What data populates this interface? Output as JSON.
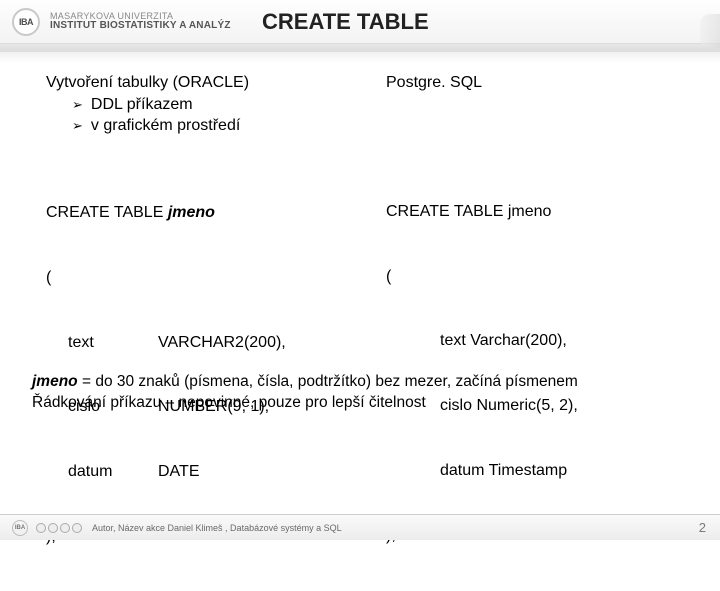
{
  "brand": {
    "logo_text": "IBA",
    "university": "MASARYKOVA UNIVERZITA",
    "institute": "INSTITUT BIOSTATISTIKY A ANALÝZ"
  },
  "title": "CREATE TABLE",
  "left": {
    "heading": "Vytvoření tabulky (ORACLE)",
    "bullets": [
      "DDL příkazem",
      "v grafickém prostředí"
    ],
    "sql": {
      "line1_a": "CREATE TABLE ",
      "line1_b": "jmeno",
      "open": "(",
      "rows": [
        {
          "col": "text",
          "type": "VARCHAR2(200),"
        },
        {
          "col": "cislo",
          "type": "NUMBER(9, 1),"
        },
        {
          "col": "datum",
          "type": "DATE"
        }
      ],
      "close": ");"
    }
  },
  "right": {
    "heading": "Postgre. SQL",
    "sql": {
      "line1": "CREATE TABLE jmeno",
      "open": "(",
      "rows": [
        "text Varchar(200),",
        "cislo Numeric(5, 2),",
        "datum Timestamp"
      ],
      "close": ");"
    }
  },
  "notes": {
    "ident": "jmeno",
    "line1_rest": " = do 30 znaků (písmena, čísla, podtržítko) bez mezer, začíná písmenem",
    "line2": "Řádkování příkazu – nepovinné, pouze pro lepší čitelnost"
  },
  "footer": {
    "logo_text": "IBA",
    "text": "Autor, Název akce   Daniel  Klimeš , Databázové systémy a SQL",
    "page": "2"
  }
}
